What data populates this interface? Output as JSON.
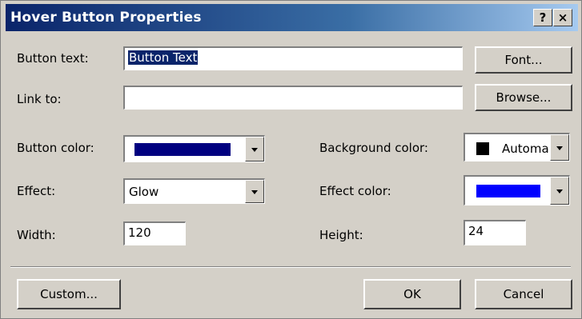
{
  "dialog": {
    "title": "Hover Button Properties",
    "help_label": "?",
    "close_label": "×"
  },
  "fields": {
    "button_text": {
      "label": "Button text:",
      "value": "Button Text"
    },
    "link_to": {
      "label": "Link to:",
      "value": ""
    },
    "button_color": {
      "label": "Button color:",
      "swatch": "#000080"
    },
    "background_color": {
      "label": "Background color:",
      "swatch": "#000000",
      "value": "Automa"
    },
    "effect": {
      "label": "Effect:",
      "value": "Glow"
    },
    "effect_color": {
      "label": "Effect color:",
      "swatch": "#0000ff"
    },
    "width": {
      "label": "Width:",
      "value": "120"
    },
    "height": {
      "label": "Height:",
      "value": "24"
    }
  },
  "buttons": {
    "font": "Font...",
    "browse": "Browse...",
    "custom": "Custom...",
    "ok": "OK",
    "cancel": "Cancel"
  }
}
